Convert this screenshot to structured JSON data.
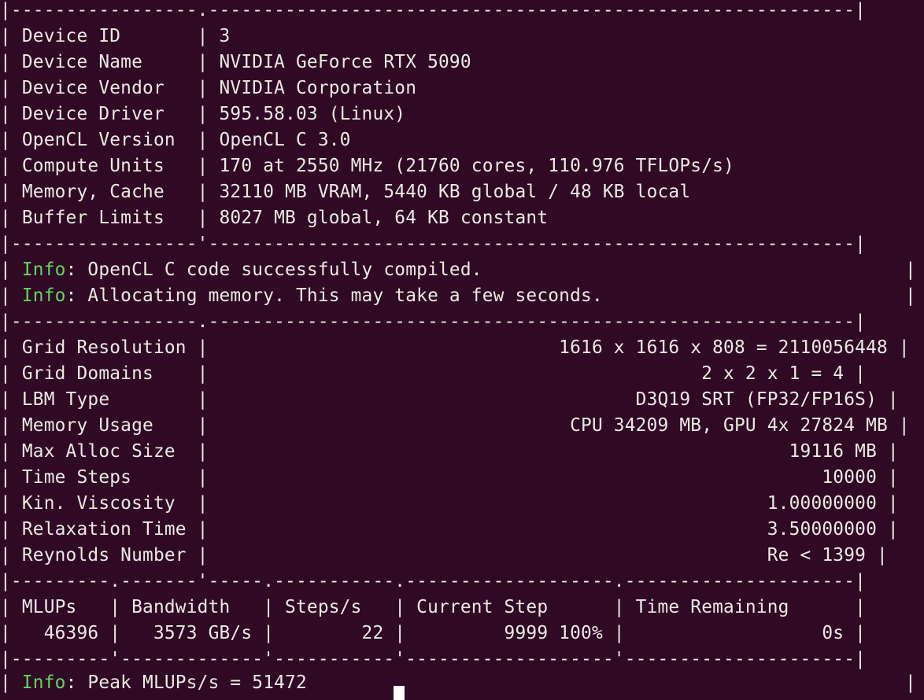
{
  "terminal": {
    "background": "#300a24",
    "foreground": "#ece9e4",
    "info_color": "#5fd75f",
    "lines": [
      {
        "kind": "border",
        "text": "|-----------------.-----------------------------------------------------------|"
      },
      {
        "kind": "plain",
        "text": "| Device ID       | 3"
      },
      {
        "kind": "plain",
        "text": "| Device Name     | NVIDIA GeForce RTX 5090"
      },
      {
        "kind": "plain",
        "text": "| Device Vendor   | NVIDIA Corporation"
      },
      {
        "kind": "plain",
        "text": "| Device Driver   | 595.58.03 (Linux)"
      },
      {
        "kind": "plain",
        "text": "| OpenCL Version  | OpenCL C 3.0"
      },
      {
        "kind": "plain",
        "text": "| Compute Units   | 170 at 2550 MHz (21760 cores, 110.976 TFLOPs/s)"
      },
      {
        "kind": "plain",
        "text": "| Memory, Cache   | 32110 MB VRAM, 5440 KB global / 48 KB local"
      },
      {
        "kind": "plain",
        "text": "| Buffer Limits   | 8027 MB global, 64 KB constant"
      },
      {
        "kind": "border",
        "text": "|-----------------'-----------------------------------------------------------|"
      },
      {
        "kind": "info",
        "prefix": "Info",
        "text": ": OpenCL C code successfully compiled.",
        "tail": "|"
      },
      {
        "kind": "info",
        "prefix": "Info",
        "text": ": Allocating memory. This may take a few seconds.",
        "tail": "|"
      },
      {
        "kind": "border",
        "text": "|-----------------.-----------------------------------------------------------|"
      },
      {
        "kind": "plain",
        "text": "| Grid Resolution |                                1616 x 1616 x 808 = 2110056448 |"
      },
      {
        "kind": "plain",
        "text": "| Grid Domains    |                                             2 x 2 x 1 = 4 |"
      },
      {
        "kind": "plain",
        "text": "| LBM Type        |                                       D3Q19 SRT (FP32/FP16S) |"
      },
      {
        "kind": "plain",
        "text": "| Memory Usage    |                                 CPU 34209 MB, GPU 4x 27824 MB |"
      },
      {
        "kind": "plain",
        "text": "| Max Alloc Size  |                                                     19116 MB |"
      },
      {
        "kind": "plain",
        "text": "| Time Steps      |                                                        10000 |"
      },
      {
        "kind": "plain",
        "text": "| Kin. Viscosity  |                                                   1.00000000 |"
      },
      {
        "kind": "plain",
        "text": "| Relaxation Time |                                                   3.50000000 |"
      },
      {
        "kind": "plain",
        "text": "| Reynolds Number |                                                   Re < 1399 |"
      },
      {
        "kind": "border",
        "text": "|---------.-------'-----.-----------.-------------------.---------------------|"
      },
      {
        "kind": "plain",
        "text": "| MLUPs   | Bandwidth   | Steps/s   | Current Step      | Time Remaining      |"
      },
      {
        "kind": "plain",
        "text": "|   46396 |   3573 GB/s |        22 |         9999 100% |                  0s |"
      },
      {
        "kind": "border",
        "text": "|---------'-------------'-----------'-------------------'---------------------|"
      },
      {
        "kind": "info",
        "prefix": "Info",
        "text": ": Peak MLUPs/s = 51472",
        "tail": "|"
      }
    ]
  }
}
